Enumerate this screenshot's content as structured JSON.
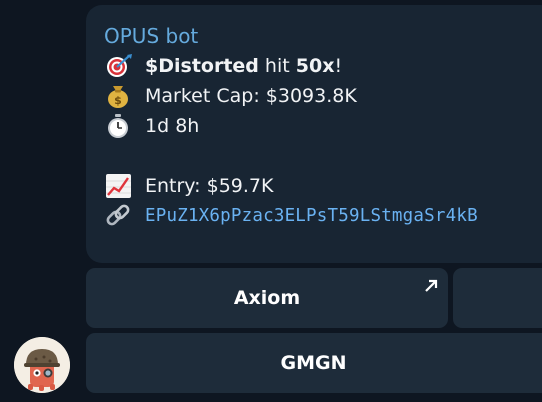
{
  "message": {
    "sender": "OPUS bot",
    "line1": {
      "ticker": "$Distorted",
      "mid": " hit ",
      "multiple": "50x",
      "end": "!"
    },
    "line2": "Market Cap: $3093.8K",
    "line3": "1d 8h",
    "line4": "Entry: $59.7K",
    "line5": "EPuZ1X6pPzac3ELPsT59LStmgaSr4kB",
    "icons": [
      "target-icon",
      "money-bag-icon",
      "stopwatch-icon",
      "chart-increasing-icon",
      "link-icon"
    ]
  },
  "buttons": {
    "axiom": "Axiom",
    "gmgn": "GMGN"
  },
  "colors": {
    "background": "#0e1621",
    "bubble": "#182533",
    "sender": "#65aadd",
    "link": "#6ab2f2",
    "button": "#1e2c3a"
  }
}
